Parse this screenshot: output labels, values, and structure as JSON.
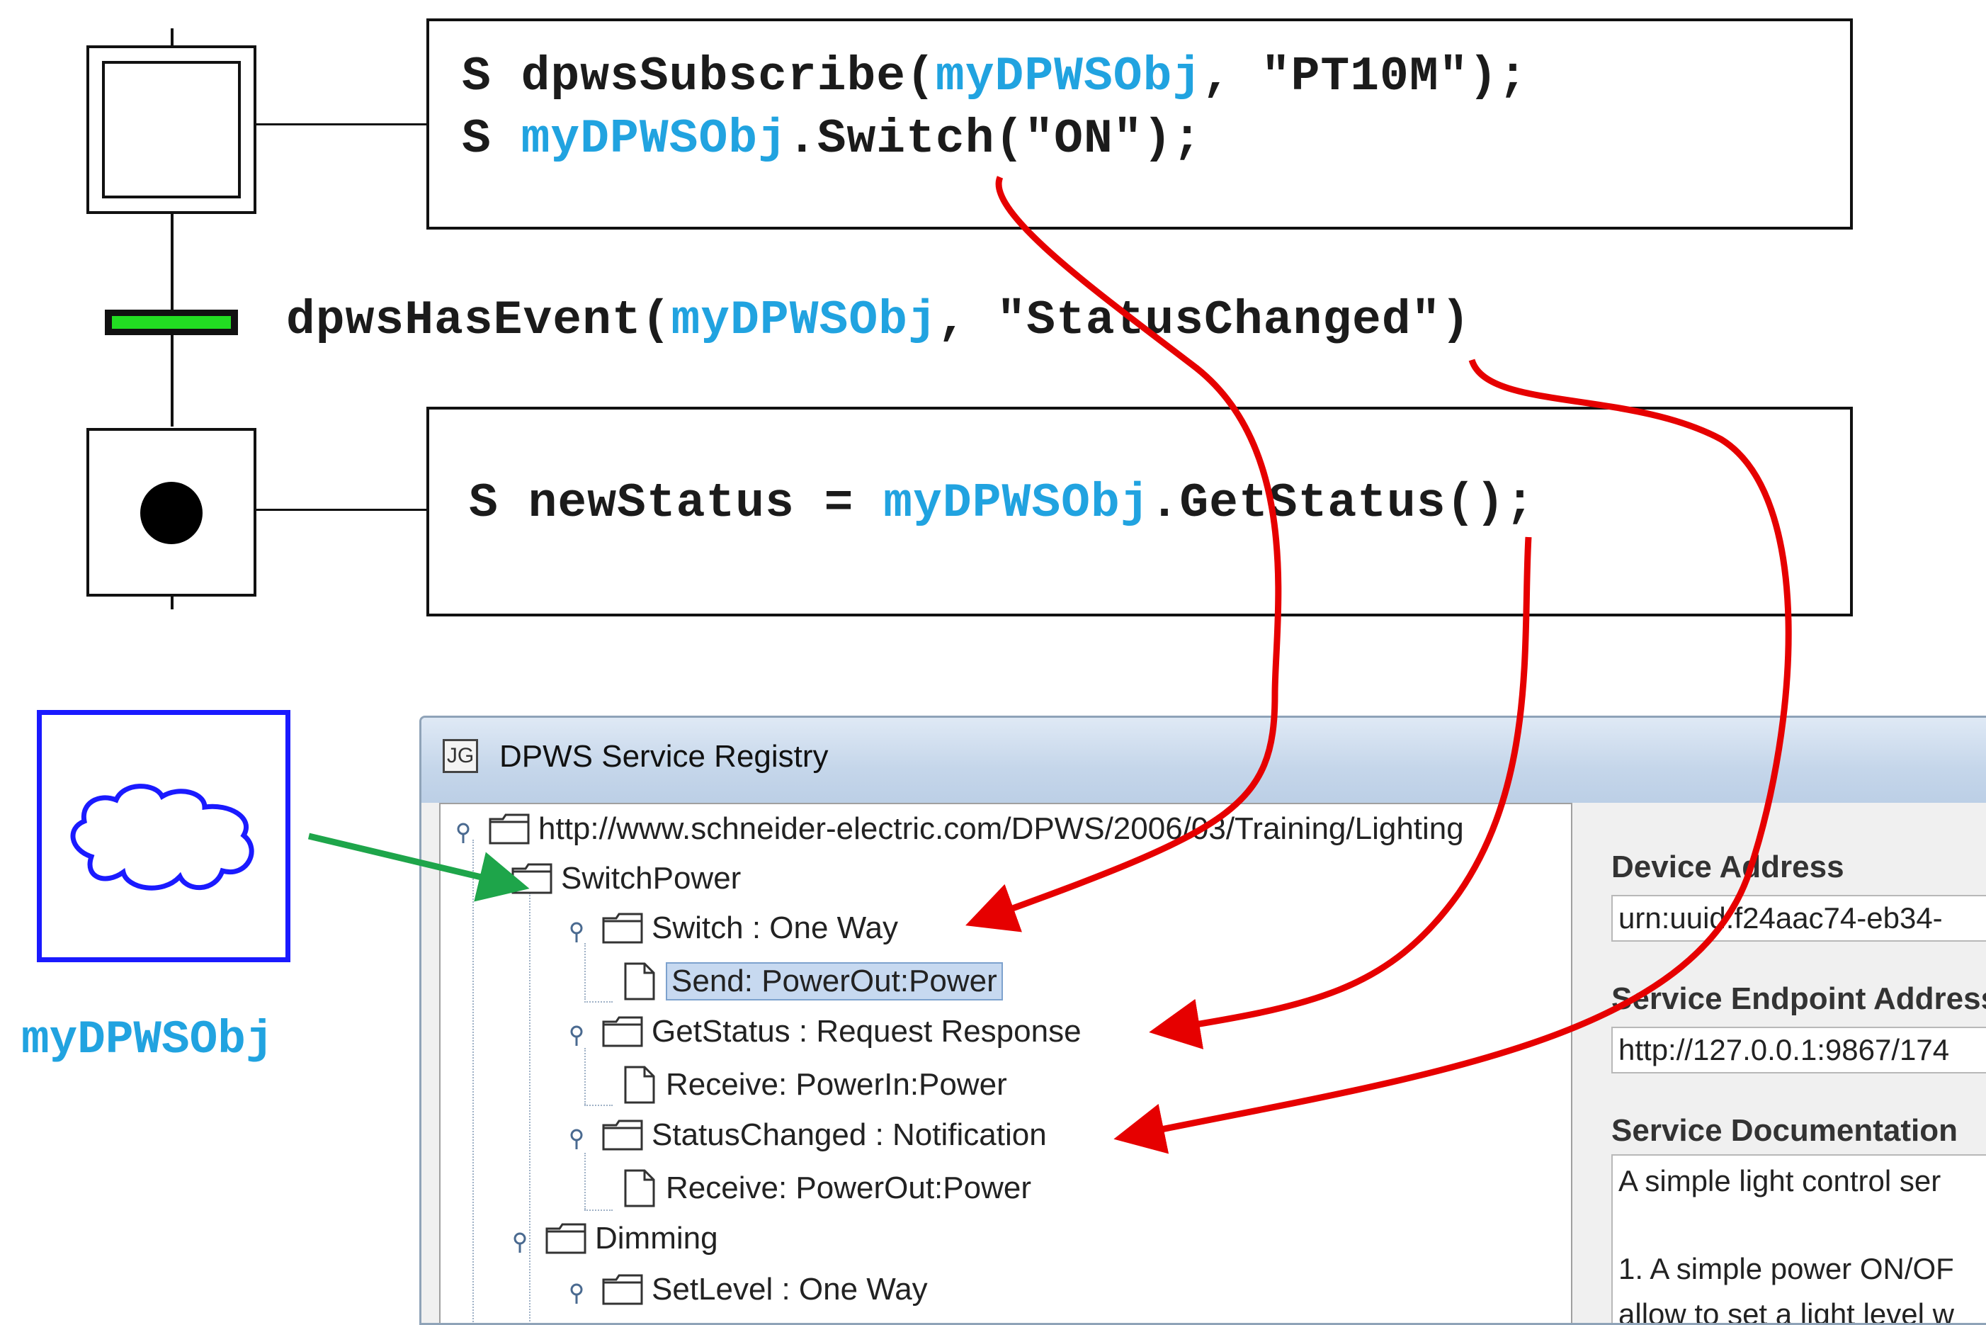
{
  "code_block_top": {
    "line1": {
      "prefix": "S ",
      "func": "dpwsSubscribe(",
      "obj": "myDPWSObj",
      "rest": ", \"PT10M\");"
    },
    "line2": {
      "prefix": "S ",
      "obj": "myDPWSObj",
      "rest": ".Switch(\"ON\");"
    }
  },
  "transition": {
    "func": "dpwsHasEvent(",
    "obj": "myDPWSObj",
    "rest": ", \"StatusChanged\")"
  },
  "code_block_bottom": {
    "prefix": "S newStatus = ",
    "obj": "myDPWSObj",
    "rest": ".GetStatus();"
  },
  "object_label": "myDPWSObj",
  "window": {
    "icon_text": "JG",
    "title": "DPWS Service Registry",
    "tree": [
      {
        "label": "http://www.schneider-electric.com/DPWS/2006/03/Training/Lighting",
        "kind": "folder"
      },
      {
        "label": "SwitchPower",
        "kind": "folder"
      },
      {
        "label": "Switch : One Way",
        "kind": "folder"
      },
      {
        "label": "Send: PowerOut:Power",
        "kind": "file",
        "selected": true
      },
      {
        "label": "GetStatus : Request Response",
        "kind": "folder"
      },
      {
        "label": "Receive: PowerIn:Power",
        "kind": "file"
      },
      {
        "label": "StatusChanged : Notification",
        "kind": "folder"
      },
      {
        "label": "Receive: PowerOut:Power",
        "kind": "file"
      },
      {
        "label": "Dimming",
        "kind": "folder"
      },
      {
        "label": "SetLevel : One Way",
        "kind": "folder"
      }
    ],
    "details": {
      "device_address_label": "Device Address",
      "device_address_value": "urn:uuid:f24aac74-eb34-",
      "endpoint_label": "Service Endpoint Address",
      "endpoint_value": "http://127.0.0.1:9867/174",
      "doc_label": "Service Documentation",
      "doc_line1": "A simple light control ser",
      "doc_line2": "1. A simple power ON/OF",
      "doc_line3": "allow to set a light level w"
    }
  },
  "colors": {
    "object_blue": "#21a3e0",
    "arrow_red": "#e60000",
    "arrow_green": "#1ea54a",
    "transition_green": "#22dd22",
    "object_box_blue": "#1a1aff"
  }
}
